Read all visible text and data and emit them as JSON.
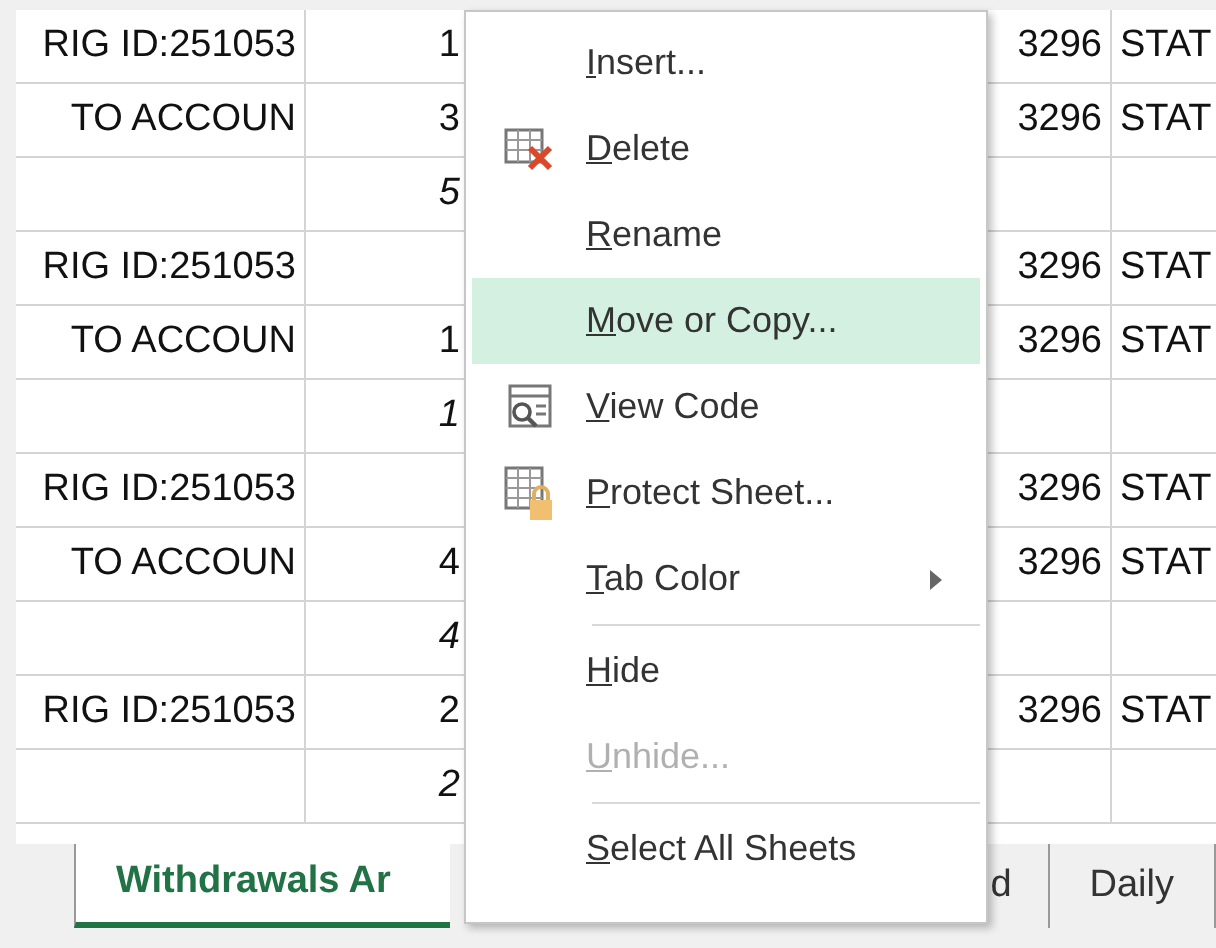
{
  "sheet": {
    "rows": [
      {
        "cells": [
          {
            "text": "RIG ID:251053",
            "italic": false
          },
          {
            "text": "1",
            "italic": false
          },
          {
            "text": "3296",
            "italic": false
          },
          {
            "text": "STAT",
            "italic": false
          }
        ]
      },
      {
        "cells": [
          {
            "text": " TO ACCOUN",
            "italic": false
          },
          {
            "text": "3",
            "italic": false
          },
          {
            "text": "3296",
            "italic": false
          },
          {
            "text": "STAT",
            "italic": false
          }
        ]
      },
      {
        "cells": [
          null,
          {
            "text": "5",
            "italic": true
          },
          null,
          null
        ]
      },
      {
        "cells": [
          {
            "text": "RIG ID:251053",
            "italic": false
          },
          null,
          {
            "text": "3296",
            "italic": false
          },
          {
            "text": "STAT",
            "italic": false
          }
        ]
      },
      {
        "cells": [
          {
            "text": " TO ACCOUN",
            "italic": false
          },
          {
            "text": "1",
            "italic": false
          },
          {
            "text": "3296",
            "italic": false
          },
          {
            "text": "STAT",
            "italic": false
          }
        ]
      },
      {
        "cells": [
          null,
          {
            "text": "1",
            "italic": true
          },
          null,
          null
        ]
      },
      {
        "cells": [
          {
            "text": "RIG ID:251053",
            "italic": false
          },
          null,
          {
            "text": "3296",
            "italic": false
          },
          {
            "text": "STAT",
            "italic": false
          }
        ]
      },
      {
        "cells": [
          {
            "text": " TO ACCOUN",
            "italic": false
          },
          {
            "text": "4",
            "italic": false
          },
          {
            "text": "3296",
            "italic": false
          },
          {
            "text": "STAT",
            "italic": false
          }
        ]
      },
      {
        "cells": [
          null,
          {
            "text": "4",
            "italic": true
          },
          null,
          null
        ]
      },
      {
        "cells": [
          {
            "text": "RIG ID:251053",
            "italic": false
          },
          {
            "text": "2",
            "italic": false
          },
          {
            "text": "3296",
            "italic": false
          },
          {
            "text": "STAT",
            "italic": false
          }
        ]
      },
      {
        "cells": [
          null,
          {
            "text": "2",
            "italic": true
          },
          null,
          null
        ]
      }
    ]
  },
  "sheet_tabs": [
    {
      "label": "Withdrawals Ar",
      "selected": true
    },
    {
      "label": "d",
      "selected": false
    },
    {
      "label": "Daily",
      "selected": false
    }
  ],
  "context_menu": {
    "items": [
      {
        "kind": "plain",
        "label": "Insert...",
        "selected": false,
        "disabled": false
      },
      {
        "kind": "delete",
        "label": "Delete",
        "selected": false,
        "disabled": false
      },
      {
        "kind": "plain",
        "label": "Rename",
        "selected": false,
        "disabled": false
      },
      {
        "kind": "plain",
        "label": "Move or Copy...",
        "selected": true,
        "disabled": false
      },
      {
        "kind": "view-code",
        "label": "View Code",
        "selected": false,
        "disabled": false
      },
      {
        "kind": "protect",
        "label": "Protect Sheet...",
        "selected": false,
        "disabled": false
      },
      {
        "kind": "plain",
        "label": "Tab Color",
        "submenu": true,
        "selected": false,
        "disabled": false
      },
      {
        "kind": "separator"
      },
      {
        "kind": "plain",
        "label": "Hide",
        "selected": false,
        "disabled": false
      },
      {
        "kind": "plain",
        "label": "Unhide...",
        "selected": false,
        "disabled": true
      },
      {
        "kind": "separator"
      },
      {
        "kind": "plain",
        "label": "Select All Sheets",
        "selected": false,
        "disabled": false
      }
    ]
  }
}
